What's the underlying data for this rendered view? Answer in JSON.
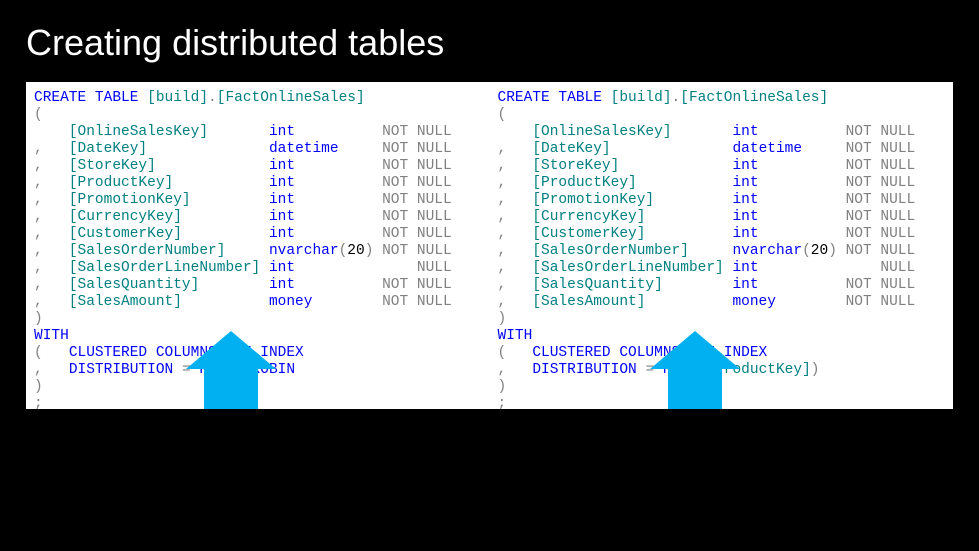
{
  "title": "Creating distributed tables",
  "code_left": {
    "create_kw": "CREATE TABLE ",
    "schema": "[build]",
    "dot": ".",
    "table": "[FactOnlineSales]",
    "open": "(",
    "columns": [
      {
        "lead": "    ",
        "name": "[OnlineSalesKey]",
        "pad1": "       ",
        "type": "int",
        "pad2": "         ",
        "nn": "NOT NULL"
      },
      {
        "lead": ",   ",
        "name": "[DateKey]",
        "pad1": "              ",
        "type": "datetime",
        "pad2": "    ",
        "nn": "NOT NULL"
      },
      {
        "lead": ",   ",
        "name": "[StoreKey]",
        "pad1": "             ",
        "type": "int",
        "pad2": "         ",
        "nn": "NOT NULL"
      },
      {
        "lead": ",   ",
        "name": "[ProductKey]",
        "pad1": "           ",
        "type": "int",
        "pad2": "         ",
        "nn": "NOT NULL"
      },
      {
        "lead": ",   ",
        "name": "[PromotionKey]",
        "pad1": "         ",
        "type": "int",
        "pad2": "         ",
        "nn": "NOT NULL"
      },
      {
        "lead": ",   ",
        "name": "[CurrencyKey]",
        "pad1": "          ",
        "type": "int",
        "pad2": "         ",
        "nn": "NOT NULL"
      },
      {
        "lead": ",   ",
        "name": "[CustomerKey]",
        "pad1": "          ",
        "type": "int",
        "pad2": "         ",
        "nn": "NOT NULL"
      },
      {
        "lead": ",   ",
        "name": "[SalesOrderNumber]",
        "pad1": "     ",
        "type": "nvarchar",
        "paren": "(20)",
        "pad2": "",
        "nn": "NOT NULL"
      },
      {
        "lead": ",   ",
        "name": "[SalesOrderLineNumber]",
        "pad1": " ",
        "type": "int",
        "pad2": "         ",
        "nn": "    NULL"
      },
      {
        "lead": ",   ",
        "name": "[SalesQuantity]",
        "pad1": "        ",
        "type": "int",
        "pad2": "         ",
        "nn": "NOT NULL"
      },
      {
        "lead": ",   ",
        "name": "[SalesAmount]",
        "pad1": "          ",
        "type": "money",
        "pad2": "       ",
        "nn": "NOT NULL"
      }
    ],
    "close": ")",
    "with": "WITH",
    "w_open": "(   ",
    "cci": "CLUSTERED COLUMNSTORE INDEX",
    "w_comma": ",   ",
    "dist_kw": "DISTRIBUTION ",
    "eq": "=",
    "dist_val": " ROUND_ROBIN",
    "dist_col": "",
    "w_close": ")",
    "semi": ";"
  },
  "code_right": {
    "create_kw": "CREATE TABLE ",
    "schema": "[build]",
    "dot": ".",
    "table": "[FactOnlineSales]",
    "open": "(",
    "columns": [
      {
        "lead": "    ",
        "name": "[OnlineSalesKey]",
        "pad1": "       ",
        "type": "int",
        "pad2": "         ",
        "nn": "NOT NULL"
      },
      {
        "lead": ",   ",
        "name": "[DateKey]",
        "pad1": "              ",
        "type": "datetime",
        "pad2": "    ",
        "nn": "NOT NULL"
      },
      {
        "lead": ",   ",
        "name": "[StoreKey]",
        "pad1": "             ",
        "type": "int",
        "pad2": "         ",
        "nn": "NOT NULL"
      },
      {
        "lead": ",   ",
        "name": "[ProductKey]",
        "pad1": "           ",
        "type": "int",
        "pad2": "         ",
        "nn": "NOT NULL"
      },
      {
        "lead": ",   ",
        "name": "[PromotionKey]",
        "pad1": "         ",
        "type": "int",
        "pad2": "         ",
        "nn": "NOT NULL"
      },
      {
        "lead": ",   ",
        "name": "[CurrencyKey]",
        "pad1": "          ",
        "type": "int",
        "pad2": "         ",
        "nn": "NOT NULL"
      },
      {
        "lead": ",   ",
        "name": "[CustomerKey]",
        "pad1": "          ",
        "type": "int",
        "pad2": "         ",
        "nn": "NOT NULL"
      },
      {
        "lead": ",   ",
        "name": "[SalesOrderNumber]",
        "pad1": "     ",
        "type": "nvarchar",
        "paren": "(20)",
        "pad2": "",
        "nn": "NOT NULL"
      },
      {
        "lead": ",   ",
        "name": "[SalesOrderLineNumber]",
        "pad1": " ",
        "type": "int",
        "pad2": "         ",
        "nn": "    NULL"
      },
      {
        "lead": ",   ",
        "name": "[SalesQuantity]",
        "pad1": "        ",
        "type": "int",
        "pad2": "         ",
        "nn": "NOT NULL"
      },
      {
        "lead": ",   ",
        "name": "[SalesAmount]",
        "pad1": "          ",
        "type": "money",
        "pad2": "       ",
        "nn": "NOT NULL"
      }
    ],
    "close": ")",
    "with": "WITH",
    "w_open": "(   ",
    "cci": "CLUSTERED COLUMNSTORE INDEX",
    "w_comma": ",   ",
    "dist_kw": "DISTRIBUTION ",
    "eq": "=",
    "dist_val": " HASH",
    "dist_col": "([ProductKey])",
    "w_close": ")",
    "semi": ";"
  },
  "colors": {
    "accent": "#00b0f0"
  }
}
